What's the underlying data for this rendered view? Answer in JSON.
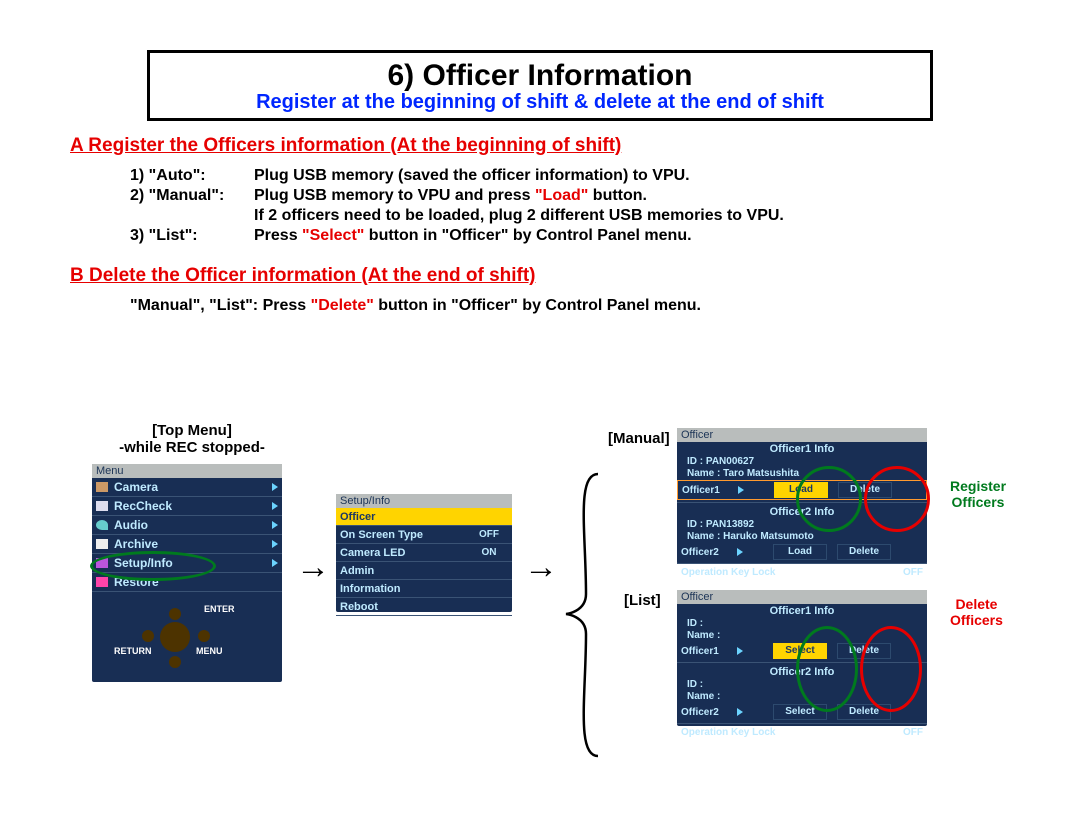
{
  "title": {
    "main": "6) Officer Information",
    "sub": "Register at the beginning of shift & delete at the end of shift"
  },
  "sectionA": {
    "heading": "A  Register the Officers information (At the beginning of shift)",
    "rows": [
      {
        "label": "1) \"Auto\":",
        "before": "Plug USB memory (saved the officer information) to VPU.",
        "hi": "",
        "after": ""
      },
      {
        "label": "2) \"Manual\":",
        "before": "Plug USB memory to VPU and press ",
        "hi": "\"Load\"",
        "after": " button."
      },
      {
        "label": "",
        "before": "If 2 officers need to be loaded, plug 2 different USB memories to VPU.",
        "hi": "",
        "after": ""
      },
      {
        "label": "3) \"List\":",
        "before": "Press ",
        "hi": "\"Select\"",
        "after": " button in \"Officer\" by Control Panel menu."
      }
    ]
  },
  "sectionB": {
    "heading": "B  Delete the Officer information (At the end of shift)",
    "before": "\"Manual\", \"List\":  Press ",
    "hi": "\"Delete\"",
    "after": " button in \"Officer\" by Control Panel menu."
  },
  "topMenu": {
    "caption1": "[Top Menu]",
    "caption2": "-while REC stopped-",
    "title": "Menu",
    "items": [
      "Camera",
      "RecCheck",
      "Audio",
      "Archive",
      "Setup/Info",
      "Restore"
    ],
    "joy": {
      "enter": "ENTER",
      "return": "RETURN",
      "menu": "MENU"
    }
  },
  "setup": {
    "title": "Setup/Info",
    "rows": [
      {
        "label": "Officer",
        "val": ""
      },
      {
        "label": "On Screen Type",
        "val": "OFF"
      },
      {
        "label": "Camera LED",
        "val": "ON"
      },
      {
        "label": "Admin",
        "val": ""
      },
      {
        "label": "Information",
        "val": ""
      },
      {
        "label": "Reboot",
        "val": ""
      }
    ]
  },
  "manual": {
    "caption": "[Manual]",
    "title": "Officer",
    "head1": "Officer1 Info",
    "id1": "ID : PAN00627",
    "nm1": "Name : Taro Matsushita",
    "actor1": "Officer1",
    "btnA": "Load",
    "btnB": "Delete",
    "head2": "Officer2 Info",
    "id2": "ID : PAN13892",
    "nm2": "Name : Haruko Matsumoto",
    "actor2": "Officer2",
    "btnA2": "Load",
    "btnB2": "Delete",
    "keylock": "Operation Key Lock",
    "keylock_val": "OFF"
  },
  "list": {
    "caption": "[List]",
    "title": "Officer",
    "head1": "Officer1 Info",
    "id1": "ID :",
    "nm1": "Name :",
    "actor1": "Officer1",
    "btnA": "Select",
    "btnB": "Delete",
    "head2": "Officer2 Info",
    "id2": "ID :",
    "nm2": "Name :",
    "actor2": "Officer2",
    "btnA2": "Select",
    "btnB2": "Delete",
    "keylock": "Operation Key Lock",
    "keylock_val": "OFF"
  },
  "sideLabels": {
    "reg1": "Register",
    "reg2": "Officers",
    "del1": "Delete",
    "del2": "Officers"
  },
  "arrow_glyph": "→"
}
